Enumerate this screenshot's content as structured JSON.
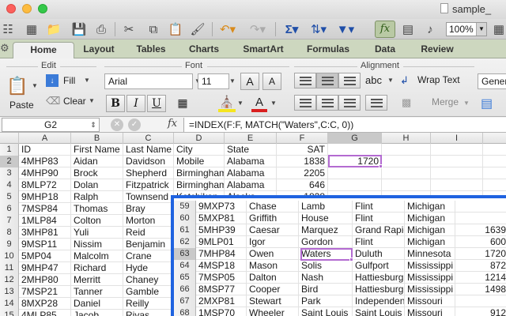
{
  "window": {
    "title": "sample_"
  },
  "toolbar": {
    "zoom": "100%"
  },
  "ribbon_tabs": [
    "Home",
    "Layout",
    "Tables",
    "Charts",
    "SmartArt",
    "Formulas",
    "Data",
    "Review"
  ],
  "ribbon": {
    "groups": {
      "edit": "Edit",
      "font": "Font",
      "alignment": "Alignment"
    },
    "paste_label": "Paste",
    "fill_label": "Fill",
    "clear_label": "Clear",
    "font_name": "Arial",
    "font_size": "11",
    "grow_label": "A",
    "shrink_label": "A",
    "bold": "B",
    "italic": "I",
    "underline": "U",
    "font_color_label": "A",
    "abc_label": "abc",
    "wrap_text_label": "Wrap Text",
    "merge_label": "Merge",
    "number_format": "Gener"
  },
  "formula_bar": {
    "cell_ref": "G2",
    "fx": "fx",
    "formula": "=INDEX(F:F, MATCH(\"Waters\",C:C, 0))"
  },
  "grid": {
    "columns": [
      "A",
      "B",
      "C",
      "D",
      "E",
      "F",
      "G",
      "H",
      "I"
    ],
    "rows": [
      {
        "n": "1",
        "cells": [
          "ID",
          "First Name",
          "Last Name",
          "City",
          "State",
          "SAT",
          "",
          "",
          ""
        ]
      },
      {
        "n": "2",
        "cells": [
          "4MHP83",
          "Aidan",
          "Davidson",
          "Mobile",
          "Alabama",
          "1838",
          "1720",
          "",
          ""
        ]
      },
      {
        "n": "3",
        "cells": [
          "4MHP90",
          "Brock",
          "Shepherd",
          "Birmingham",
          "Alabama",
          "2205",
          "",
          "",
          ""
        ]
      },
      {
        "n": "4",
        "cells": [
          "8MLP72",
          "Dolan",
          "Fitzpatrick",
          "Birmingham",
          "Alabama",
          "646",
          "",
          "",
          ""
        ]
      },
      {
        "n": "5",
        "cells": [
          "9MHP18",
          "Ralph",
          "Townsend",
          "Ketchikan",
          "Alaska",
          "1828",
          "",
          "",
          ""
        ]
      },
      {
        "n": "6",
        "cells": [
          "7MSP84",
          "Thomas",
          "Bray",
          "",
          "",
          "",
          "",
          "",
          ""
        ]
      },
      {
        "n": "7",
        "cells": [
          "1MLP84",
          "Colton",
          "Morton",
          "",
          "",
          "",
          "",
          "",
          ""
        ]
      },
      {
        "n": "8",
        "cells": [
          "3MHP81",
          "Yuli",
          "Reid",
          "",
          "",
          "",
          "",
          "",
          ""
        ]
      },
      {
        "n": "9",
        "cells": [
          "9MSP11",
          "Nissim",
          "Benjamin",
          "",
          "",
          "",
          "",
          "",
          ""
        ]
      },
      {
        "n": "10",
        "cells": [
          "5MP04",
          "Malcolm",
          "Crane",
          "",
          "",
          "",
          "",
          "",
          ""
        ]
      },
      {
        "n": "11",
        "cells": [
          "9MHP47",
          "Richard",
          "Hyde",
          "",
          "",
          "",
          "",
          "",
          ""
        ]
      },
      {
        "n": "12",
        "cells": [
          "2MHP80",
          "Merritt",
          "Chaney",
          "",
          "",
          "",
          "",
          "",
          ""
        ]
      },
      {
        "n": "13",
        "cells": [
          "7MSP21",
          "Tanner",
          "Gamble",
          "",
          "",
          "",
          "",
          "",
          ""
        ]
      },
      {
        "n": "14",
        "cells": [
          "8MXP28",
          "Daniel",
          "Reilly",
          "",
          "",
          "",
          "",
          "",
          ""
        ]
      },
      {
        "n": "15",
        "cells": [
          "4MLP85",
          "Jacob",
          "Rivas",
          "",
          "",
          "",
          "",
          "",
          ""
        ]
      }
    ]
  },
  "zoom_inset": {
    "rows": [
      {
        "n": "59",
        "cells": [
          "9MXP73",
          "Chase",
          "Lamb",
          "Flint",
          "Michigan",
          ""
        ]
      },
      {
        "n": "60",
        "cells": [
          "5MXP81",
          "Griffith",
          "House",
          "Flint",
          "Michigan",
          ""
        ]
      },
      {
        "n": "61",
        "cells": [
          "5MHP39",
          "Caesar",
          "Marquez",
          "Grand Rapids",
          "Michigan",
          "1639"
        ]
      },
      {
        "n": "62",
        "cells": [
          "9MLP01",
          "Igor",
          "Gordon",
          "Flint",
          "Michigan",
          "600"
        ]
      },
      {
        "n": "63",
        "cells": [
          "7MHP84",
          "Owen",
          "Waters",
          "Duluth",
          "Minnesota",
          "1720"
        ]
      },
      {
        "n": "64",
        "cells": [
          "4MSP18",
          "Mason",
          "Solis",
          "Gulfport",
          "Mississippi",
          "872"
        ]
      },
      {
        "n": "65",
        "cells": [
          "7MSP05",
          "Dalton",
          "Nash",
          "Hattiesburg",
          "Mississippi",
          "1214"
        ]
      },
      {
        "n": "66",
        "cells": [
          "8MSP77",
          "Cooper",
          "Bird",
          "Hattiesburg",
          "Mississippi",
          "1498"
        ]
      },
      {
        "n": "67",
        "cells": [
          "2MXP81",
          "Stewart",
          "Park",
          "Independence",
          "Missouri",
          ""
        ]
      },
      {
        "n": "68",
        "cells": [
          "1MSP70",
          "Wheeler",
          "Saint Louis",
          "Saint Louis",
          "Missouri",
          "912"
        ]
      }
    ]
  },
  "colors": {
    "accent": "#1f63e0",
    "selection": "#b36bd1",
    "fx_active": "#b9c9a4"
  }
}
